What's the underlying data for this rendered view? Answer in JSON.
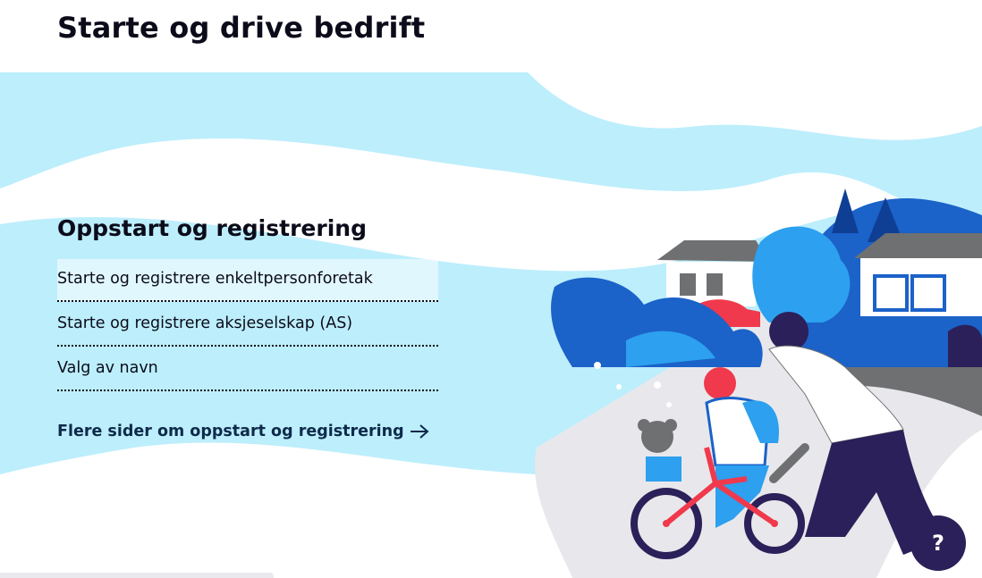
{
  "page": {
    "title": "Starte og drive bedrift"
  },
  "section": {
    "title": "Oppstart og registrering",
    "links": [
      {
        "label": "Starte og registrere enkeltpersonforetak"
      },
      {
        "label": "Starte og registrere aksjeselskap (AS)"
      },
      {
        "label": "Valg av navn"
      }
    ],
    "more_link": "Flere sider om oppstart og registrering"
  },
  "help": {
    "label": "?"
  },
  "colors": {
    "sky": "#bdeefc",
    "blue": "#1b62c9",
    "navy": "#2b2059",
    "red": "#f0394c",
    "grey": "#6f7071"
  },
  "icons": [
    "arrow-right-icon",
    "question-icon"
  ]
}
